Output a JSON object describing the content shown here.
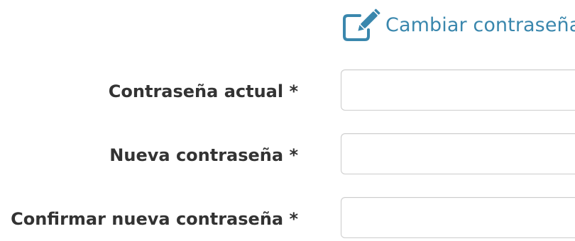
{
  "header": {
    "title": "Cambiar contraseña",
    "icon": "edit-icon",
    "accent_color": "#3a87ad"
  },
  "form": {
    "fields": [
      {
        "label": "Contraseña actual *",
        "value": "",
        "placeholder": ""
      },
      {
        "label": "Nueva contraseña *",
        "value": "",
        "placeholder": ""
      },
      {
        "label": "Confirmar nueva contraseña *",
        "value": "",
        "placeholder": ""
      }
    ]
  }
}
